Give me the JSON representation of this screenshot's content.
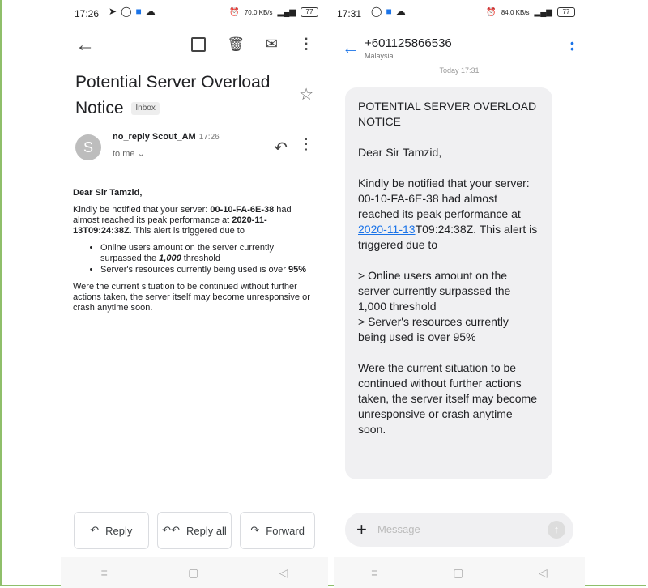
{
  "email": {
    "status": {
      "time": "17:26",
      "net": "70.0 KB/s",
      "battery": "77"
    },
    "subject": "Potential Server Overload Notice",
    "inbox_badge": "Inbox",
    "avatar_letter": "S",
    "sender_name": "no_reply Scout_AM",
    "sender_time": "17:26",
    "to_line": "to me",
    "greeting": "Dear Sir Tamzid,",
    "p1_a": "Kindly be notified that your server: ",
    "p1_server": "00-10-FA-6E-38",
    "p1_b": " had almost reached its peak performance at ",
    "p1_ts": "2020-11-13T09:24:38Z",
    "p1_c": ". This alert is triggered due to",
    "bullet1_a": "Online users amount on the server currently surpassed the ",
    "bullet1_num": "1,000",
    "bullet1_b": " threshold",
    "bullet2_a": "Server's resources currently being used is over ",
    "bullet2_pct": "95%",
    "p2": "Were the current situation to be continued without further actions taken, the server itself may become unresponsive or crash anytime soon.",
    "buttons": {
      "reply": "Reply",
      "reply_all": "Reply all",
      "forward": "Forward"
    }
  },
  "sms": {
    "status": {
      "time": "17:31",
      "net": "84.0 KB/s",
      "battery": "77"
    },
    "number": "+601125866536",
    "country": "Malaysia",
    "date": "Today 17:31",
    "title": "POTENTIAL SERVER OVERLOAD NOTICE",
    "greeting": "Dear Sir Tamzid,",
    "p1_a": "Kindly be notified that your server: 00-10-FA-6E-38 had almost reached its peak performance at ",
    "p1_link": "2020-11-13",
    "p1_b": "T09:24:38Z. This alert is triggered due to",
    "line1": "> Online users amount on the server currently surpassed the 1,000 threshold",
    "line2": "> Server's resources currently being used is over 95%",
    "p2": "Were the current situation to be continued without further actions taken, the server itself may become unresponsive or crash anytime soon.",
    "compose_placeholder": "Message"
  }
}
